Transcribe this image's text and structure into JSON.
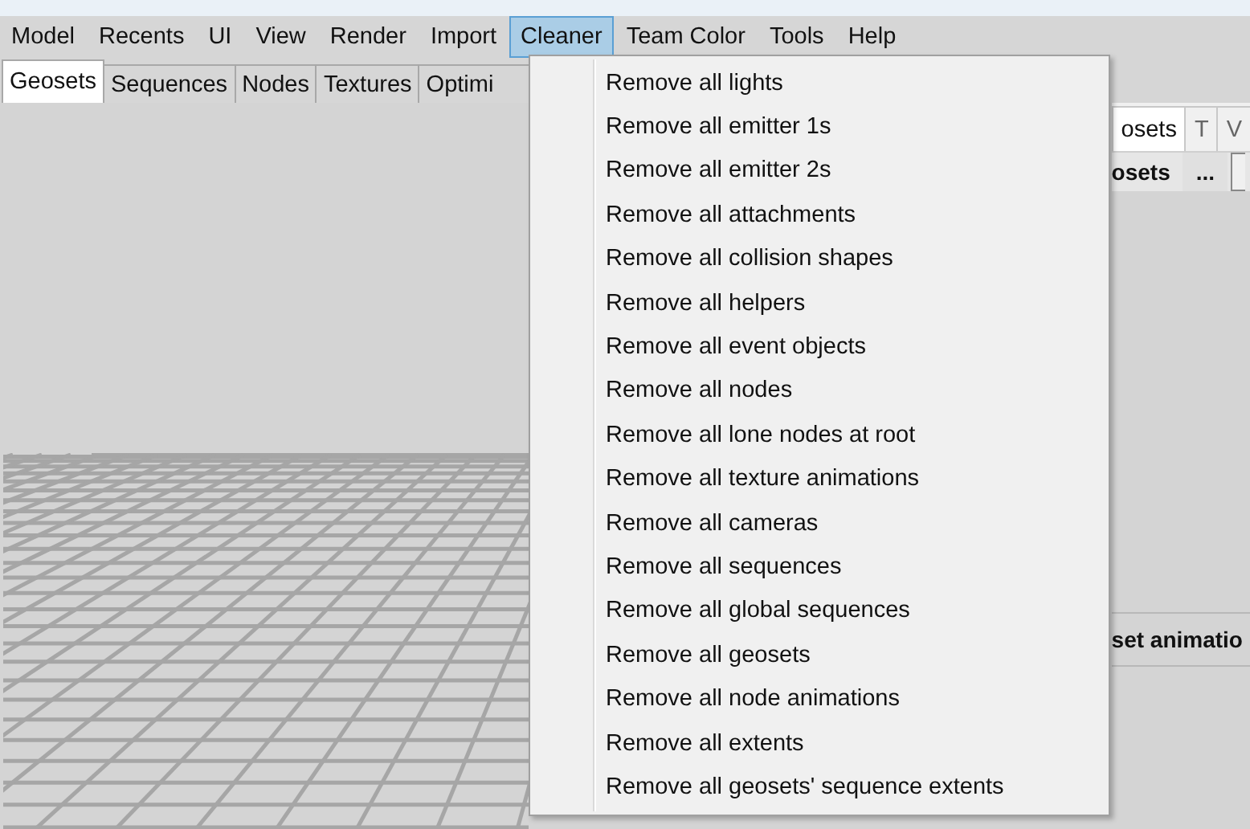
{
  "menu_bar": [
    {
      "label": "Model",
      "selected": false
    },
    {
      "label": "Recents",
      "selected": false
    },
    {
      "label": "UI",
      "selected": false
    },
    {
      "label": "View",
      "selected": false
    },
    {
      "label": "Render",
      "selected": false
    },
    {
      "label": "Import",
      "selected": false
    },
    {
      "label": "Cleaner",
      "selected": true
    },
    {
      "label": "Team Color",
      "selected": false
    },
    {
      "label": "Tools",
      "selected": false
    },
    {
      "label": "Help",
      "selected": false
    }
  ],
  "tabs": [
    {
      "label": "Geosets",
      "selected": true
    },
    {
      "label": "Sequences",
      "selected": false
    },
    {
      "label": "Nodes",
      "selected": false
    },
    {
      "label": "Textures",
      "selected": false
    },
    {
      "label": "Optimi",
      "selected": false
    }
  ],
  "right_panel": {
    "tabs": [
      {
        "label": "osets",
        "selected": true
      },
      {
        "label": "T",
        "selected": false
      },
      {
        "label": "V",
        "selected": false
      }
    ],
    "header": "osets",
    "more_button": "...",
    "section": "set animatio"
  },
  "dropdown": {
    "items": [
      "Remove all lights",
      "Remove all emitter 1s",
      "Remove all emitter 2s",
      "Remove all attachments",
      "Remove all collision shapes",
      "Remove all helpers",
      "Remove all event objects",
      "Remove all nodes",
      "Remove all lone nodes at root",
      "Remove all texture animations",
      "Remove all cameras",
      "Remove all sequences",
      "Remove all global sequences",
      "Remove all geosets",
      "Remove all node animations",
      "Remove all extents",
      "Remove all geosets' sequence extents"
    ]
  }
}
